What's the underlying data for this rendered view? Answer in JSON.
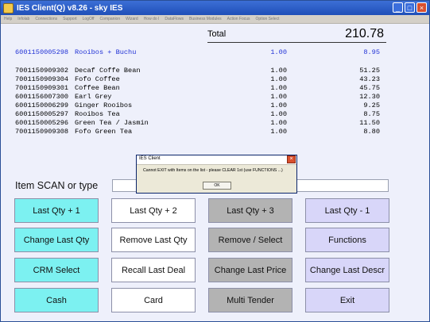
{
  "window": {
    "title": "IES Client(Q) v8.26 - sky IES"
  },
  "menu": [
    "Help",
    "Infolab",
    "Connections",
    "Support",
    "LogOff",
    "Companion",
    "Wizard",
    "How do I",
    "DataFlows",
    "Business Modules",
    "Action Focus",
    "Option Select"
  ],
  "total": {
    "label": "Total",
    "value": "210.78"
  },
  "items": [
    {
      "code": "6001150005298",
      "desc": "Rooibos + Buchu",
      "qty": "1.00",
      "amount": "8.95"
    },
    {
      "code": "7001150909302",
      "desc": "Decaf Coffe Bean",
      "qty": "1.00",
      "amount": "51.25"
    },
    {
      "code": "7001150909304",
      "desc": "Fofo Coffee",
      "qty": "1.00",
      "amount": "43.23"
    },
    {
      "code": "7001150909301",
      "desc": "Coffee Bean",
      "qty": "1.00",
      "amount": "45.75"
    },
    {
      "code": "6001156007300",
      "desc": "Earl Grey",
      "qty": "1.00",
      "amount": "12.30"
    },
    {
      "code": "6001150006299",
      "desc": "Ginger Rooibos",
      "qty": "1.00",
      "amount": "9.25"
    },
    {
      "code": "6001150005297",
      "desc": "Rooibos Tea",
      "qty": "1.00",
      "amount": "8.75"
    },
    {
      "code": "6001150005296",
      "desc": "Green Tea / Jasmin",
      "qty": "1.00",
      "amount": "11.50"
    },
    {
      "code": "7001150909308",
      "desc": "Fofo Green Tea",
      "qty": "1.00",
      "amount": "8.80"
    }
  ],
  "scan": {
    "label": "Item SCAN or type",
    "value": ""
  },
  "buttons": {
    "last_qty_plus_1": "Last Qty + 1",
    "last_qty_plus_2": "Last Qty + 2",
    "last_qty_plus_3": "Last Qty + 3",
    "last_qty_minus_1": "Last Qty - 1",
    "change_last_qty": "Change Last Qty",
    "remove_last_qty": "Remove Last Qty",
    "remove_select": "Remove / Select",
    "functions": "Functions",
    "crm_select": "CRM Select",
    "recall_last_deal": "Recall Last Deal",
    "change_last_price": "Change Last Price",
    "change_last_descr": "Change Last Descr",
    "cash": "Cash",
    "card": "Card",
    "multi_tender": "Multi Tender",
    "exit": "Exit"
  },
  "dialog": {
    "title": "IES Client",
    "message": "Cannot EXIT with Items on the list - please CLEAR 1st (use FUNCTIONS ...)",
    "ok": "OK"
  },
  "colors": {
    "highlight_text": "#2233d6",
    "cyan_button": "#7cf1f1",
    "grey_button": "#b3b3b3",
    "lavender_button": "#d8d6f9",
    "background": "#eef0fb"
  }
}
